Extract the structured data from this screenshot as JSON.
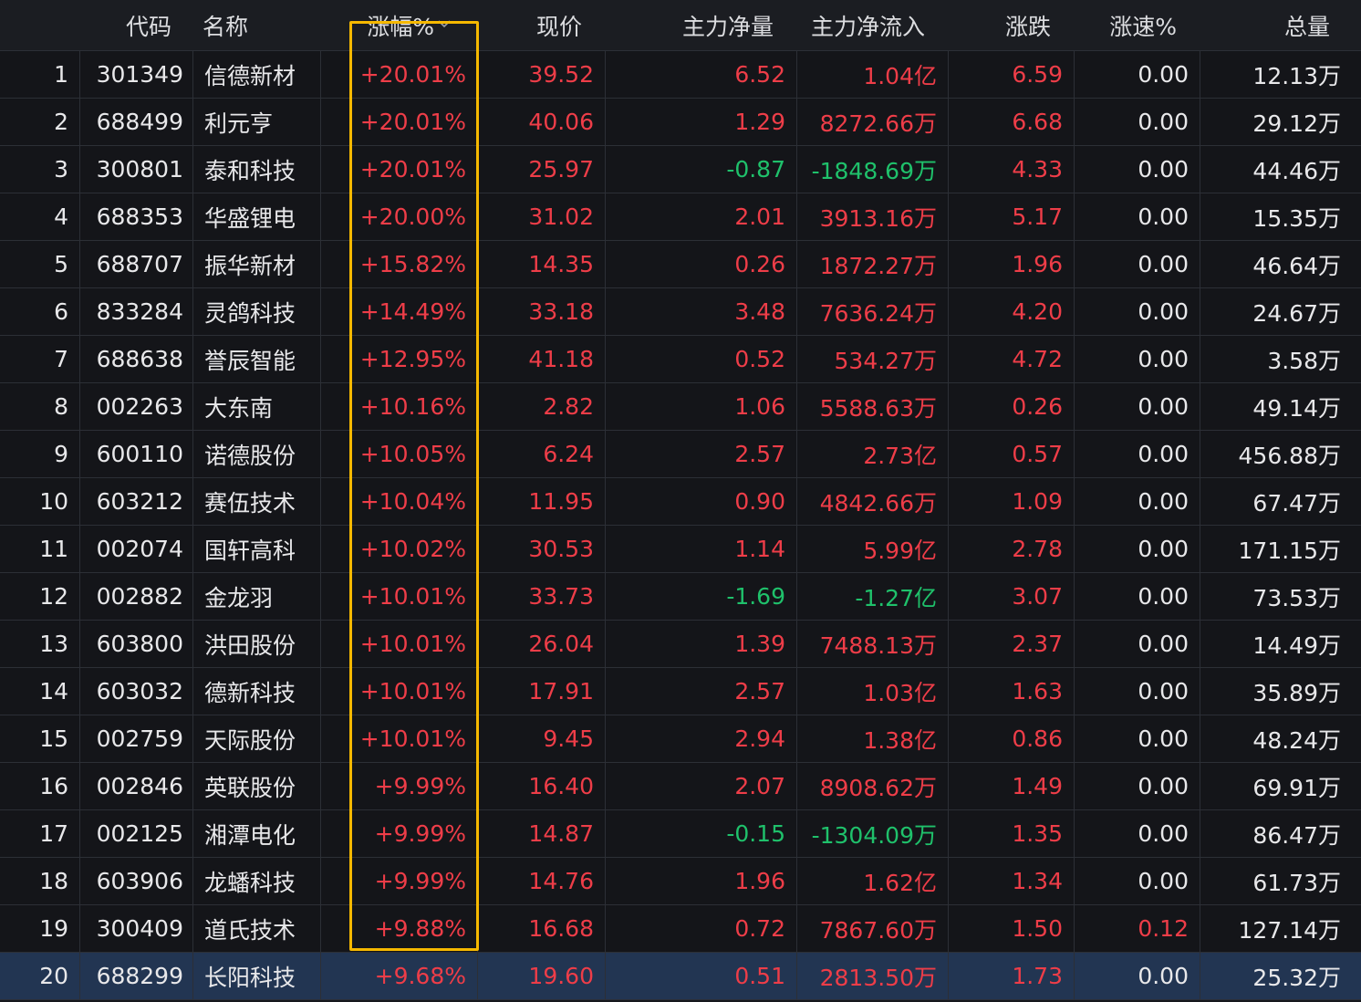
{
  "header": {
    "code": "代码",
    "name": "名称",
    "pct": "涨幅%",
    "price": "现价",
    "net": "主力净量",
    "inflow": "主力净流入",
    "chg": "涨跌",
    "speed": "涨速%",
    "vol": "总量",
    "sort_icon": "chevron-down-icon"
  },
  "colors": {
    "up": "#ee3d48",
    "down": "#1fc16b",
    "highlight": "#f5b800",
    "selected_row": "#223552"
  },
  "selected_index": 19,
  "rows": [
    {
      "idx": "1",
      "code": "301349",
      "name": "信德新材",
      "pct": "+20.01%",
      "price": "39.52",
      "net": "6.52",
      "inflow": "1.04亿",
      "chg": "6.59",
      "speed": "0.00",
      "vol": "12.13万"
    },
    {
      "idx": "2",
      "code": "688499",
      "name": "利元亨",
      "pct": "+20.01%",
      "price": "40.06",
      "net": "1.29",
      "inflow": "8272.66万",
      "chg": "6.68",
      "speed": "0.00",
      "vol": "29.12万"
    },
    {
      "idx": "3",
      "code": "300801",
      "name": "泰和科技",
      "pct": "+20.01%",
      "price": "25.97",
      "net": "-0.87",
      "inflow": "-1848.69万",
      "chg": "4.33",
      "speed": "0.00",
      "vol": "44.46万"
    },
    {
      "idx": "4",
      "code": "688353",
      "name": "华盛锂电",
      "pct": "+20.00%",
      "price": "31.02",
      "net": "2.01",
      "inflow": "3913.16万",
      "chg": "5.17",
      "speed": "0.00",
      "vol": "15.35万"
    },
    {
      "idx": "5",
      "code": "688707",
      "name": "振华新材",
      "pct": "+15.82%",
      "price": "14.35",
      "net": "0.26",
      "inflow": "1872.27万",
      "chg": "1.96",
      "speed": "0.00",
      "vol": "46.64万"
    },
    {
      "idx": "6",
      "code": "833284",
      "name": "灵鸽科技",
      "pct": "+14.49%",
      "price": "33.18",
      "net": "3.48",
      "inflow": "7636.24万",
      "chg": "4.20",
      "speed": "0.00",
      "vol": "24.67万"
    },
    {
      "idx": "7",
      "code": "688638",
      "name": "誉辰智能",
      "pct": "+12.95%",
      "price": "41.18",
      "net": "0.52",
      "inflow": "534.27万",
      "chg": "4.72",
      "speed": "0.00",
      "vol": "3.58万"
    },
    {
      "idx": "8",
      "code": "002263",
      "name": "大东南",
      "pct": "+10.16%",
      "price": "2.82",
      "net": "1.06",
      "inflow": "5588.63万",
      "chg": "0.26",
      "speed": "0.00",
      "vol": "49.14万"
    },
    {
      "idx": "9",
      "code": "600110",
      "name": "诺德股份",
      "pct": "+10.05%",
      "price": "6.24",
      "net": "2.57",
      "inflow": "2.73亿",
      "chg": "0.57",
      "speed": "0.00",
      "vol": "456.88万"
    },
    {
      "idx": "10",
      "code": "603212",
      "name": "赛伍技术",
      "pct": "+10.04%",
      "price": "11.95",
      "net": "0.90",
      "inflow": "4842.66万",
      "chg": "1.09",
      "speed": "0.00",
      "vol": "67.47万"
    },
    {
      "idx": "11",
      "code": "002074",
      "name": "国轩高科",
      "pct": "+10.02%",
      "price": "30.53",
      "net": "1.14",
      "inflow": "5.99亿",
      "chg": "2.78",
      "speed": "0.00",
      "vol": "171.15万"
    },
    {
      "idx": "12",
      "code": "002882",
      "name": "金龙羽",
      "pct": "+10.01%",
      "price": "33.73",
      "net": "-1.69",
      "inflow": "-1.27亿",
      "chg": "3.07",
      "speed": "0.00",
      "vol": "73.53万"
    },
    {
      "idx": "13",
      "code": "603800",
      "name": "洪田股份",
      "pct": "+10.01%",
      "price": "26.04",
      "net": "1.39",
      "inflow": "7488.13万",
      "chg": "2.37",
      "speed": "0.00",
      "vol": "14.49万"
    },
    {
      "idx": "14",
      "code": "603032",
      "name": "德新科技",
      "pct": "+10.01%",
      "price": "17.91",
      "net": "2.57",
      "inflow": "1.03亿",
      "chg": "1.63",
      "speed": "0.00",
      "vol": "35.89万"
    },
    {
      "idx": "15",
      "code": "002759",
      "name": "天际股份",
      "pct": "+10.01%",
      "price": "9.45",
      "net": "2.94",
      "inflow": "1.38亿",
      "chg": "0.86",
      "speed": "0.00",
      "vol": "48.24万"
    },
    {
      "idx": "16",
      "code": "002846",
      "name": "英联股份",
      "pct": "+9.99%",
      "price": "16.40",
      "net": "2.07",
      "inflow": "8908.62万",
      "chg": "1.49",
      "speed": "0.00",
      "vol": "69.91万"
    },
    {
      "idx": "17",
      "code": "002125",
      "name": "湘潭电化",
      "pct": "+9.99%",
      "price": "14.87",
      "net": "-0.15",
      "inflow": "-1304.09万",
      "chg": "1.35",
      "speed": "0.00",
      "vol": "86.47万"
    },
    {
      "idx": "18",
      "code": "603906",
      "name": "龙蟠科技",
      "pct": "+9.99%",
      "price": "14.76",
      "net": "1.96",
      "inflow": "1.62亿",
      "chg": "1.34",
      "speed": "0.00",
      "vol": "61.73万"
    },
    {
      "idx": "19",
      "code": "300409",
      "name": "道氏技术",
      "pct": "+9.88%",
      "price": "16.68",
      "net": "0.72",
      "inflow": "7867.60万",
      "chg": "1.50",
      "speed": "0.12",
      "vol": "127.14万"
    },
    {
      "idx": "20",
      "code": "688299",
      "name": "长阳科技",
      "pct": "+9.68%",
      "price": "19.60",
      "net": "0.51",
      "inflow": "2813.50万",
      "chg": "1.73",
      "speed": "0.00",
      "vol": "25.32万"
    }
  ]
}
